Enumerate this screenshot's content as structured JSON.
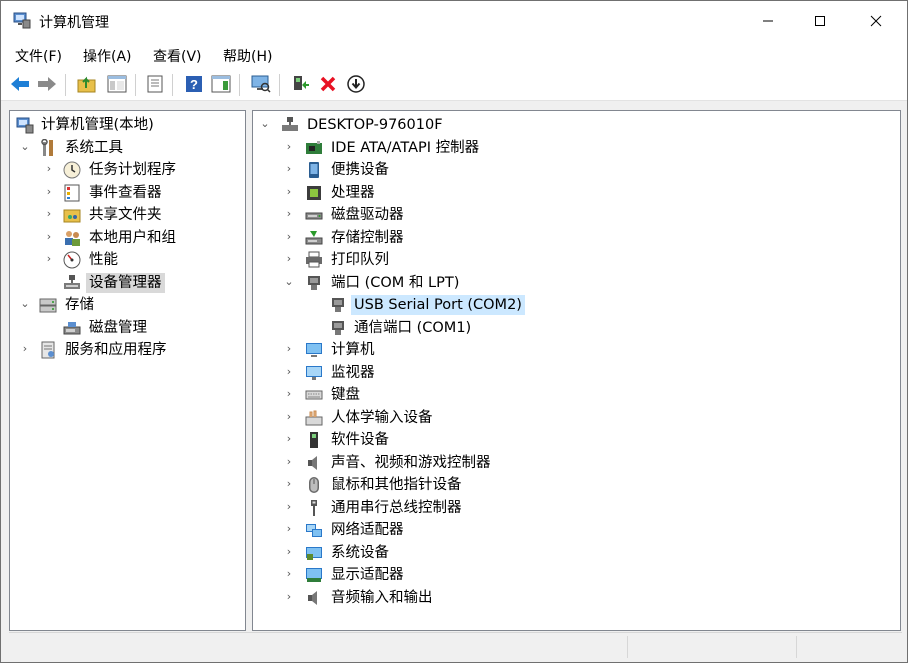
{
  "window": {
    "title": "计算机管理"
  },
  "menu": [
    "文件(F)",
    "操作(A)",
    "查看(V)",
    "帮助(H)"
  ],
  "toolbar": {
    "buttons": [
      "back-icon",
      "forward-icon",
      "up-folder-icon",
      "show-hide-tree-icon",
      "properties-icon",
      "help-icon",
      "show-action-pane-icon",
      "scan-hardware-icon",
      "update-driver-icon",
      "uninstall-icon",
      "disable-device-icon"
    ]
  },
  "left_tree": {
    "root": "计算机管理(本地)",
    "system_tools": "系统工具",
    "task_scheduler": "任务计划程序",
    "event_viewer": "事件查看器",
    "shared_folders": "共享文件夹",
    "local_users": "本地用户和组",
    "performance": "性能",
    "device_manager": "设备管理器",
    "storage": "存储",
    "disk_management": "磁盘管理",
    "services_apps": "服务和应用程序"
  },
  "right_tree": {
    "root": "DESKTOP-976010F",
    "items": [
      "IDE ATA/ATAPI 控制器",
      "便携设备",
      "处理器",
      "磁盘驱动器",
      "存储控制器",
      "打印队列",
      "端口 (COM 和 LPT)",
      "USB Serial Port (COM2)",
      "通信端口 (COM1)",
      "计算机",
      "监视器",
      "键盘",
      "人体学输入设备",
      "软件设备",
      "声音、视频和游戏控制器",
      "鼠标和其他指针设备",
      "通用串行总线控制器",
      "网络适配器",
      "系统设备",
      "显示适配器",
      "音频输入和输出"
    ]
  },
  "colors": {
    "selection_blue": "#cce8ff",
    "selection_gray": "#d9d9d9",
    "accent_blue": "#0078d7",
    "delete_red": "#e81123"
  }
}
